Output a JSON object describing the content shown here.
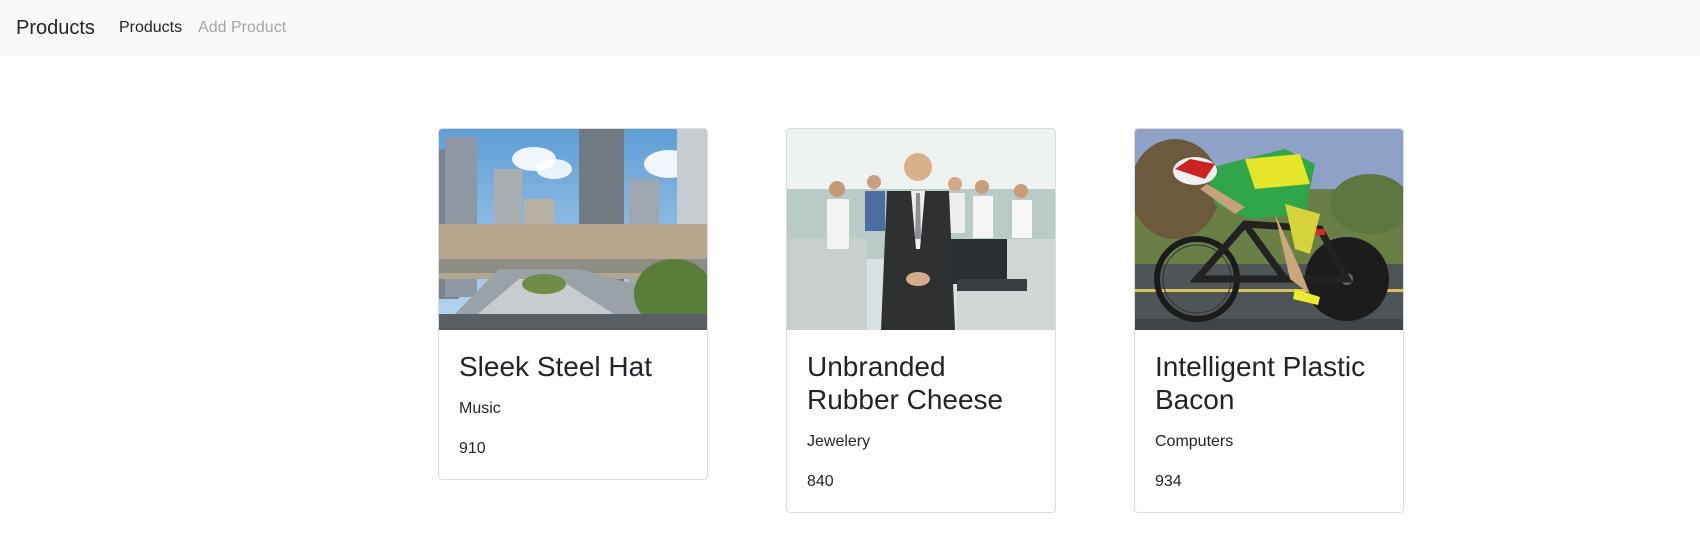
{
  "navbar": {
    "brand": "Products",
    "links": [
      {
        "label": "Products"
      },
      {
        "label": "Add Product"
      }
    ]
  },
  "products": [
    {
      "name": "Sleek Steel Hat",
      "category": "Music",
      "price": "910",
      "image": "city-skyline-photo"
    },
    {
      "name": "Unbranded Rubber Cheese",
      "category": "Jewelery",
      "price": "840",
      "image": "office-team-photo"
    },
    {
      "name": "Intelligent Plastic Bacon",
      "category": "Computers",
      "price": "934",
      "image": "cyclist-photo"
    }
  ]
}
